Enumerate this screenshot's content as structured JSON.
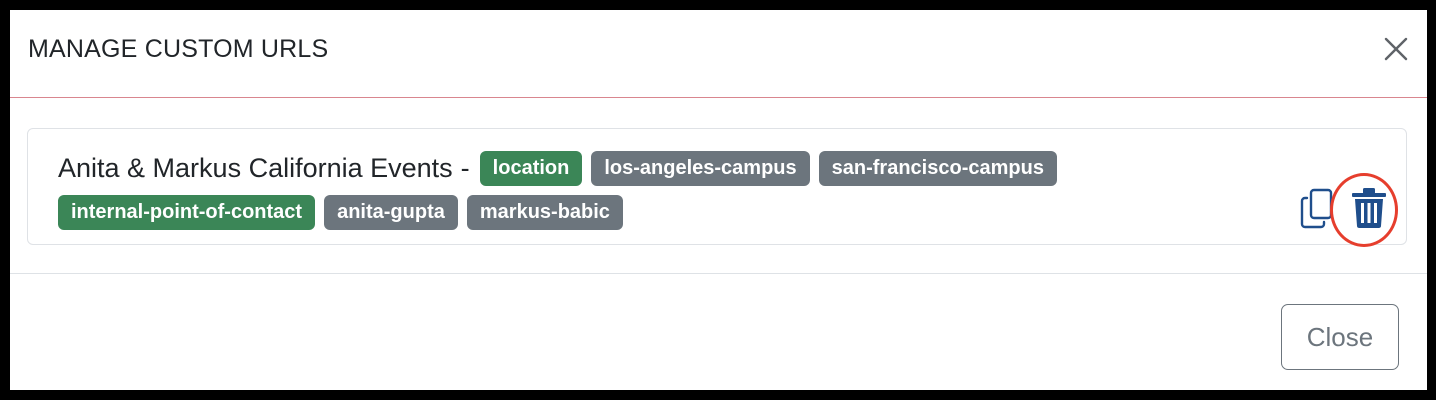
{
  "modal": {
    "title": "MANAGE CUSTOM URLS",
    "close_icon": "close-x-icon",
    "footer": {
      "close_label": "Close"
    }
  },
  "custom_url": {
    "name": "Anita & Markus California Events",
    "separator": "-",
    "tags": {
      "location": "location",
      "los_angeles_campus": "los-angeles-campus",
      "san_francisco_campus": "san-francisco-campus",
      "internal_point_of_contact": "internal-point-of-contact",
      "anita_gupta": "anita-gupta",
      "markus_babic": "markus-babic"
    },
    "actions": {
      "copy_icon": "copy-icon",
      "delete_icon": "trash-icon"
    }
  },
  "colors": {
    "key_badge": "#3b8657",
    "value_badge": "#6c757d",
    "icon_primary": "#1f4e8c",
    "highlight": "#e63e2d"
  }
}
